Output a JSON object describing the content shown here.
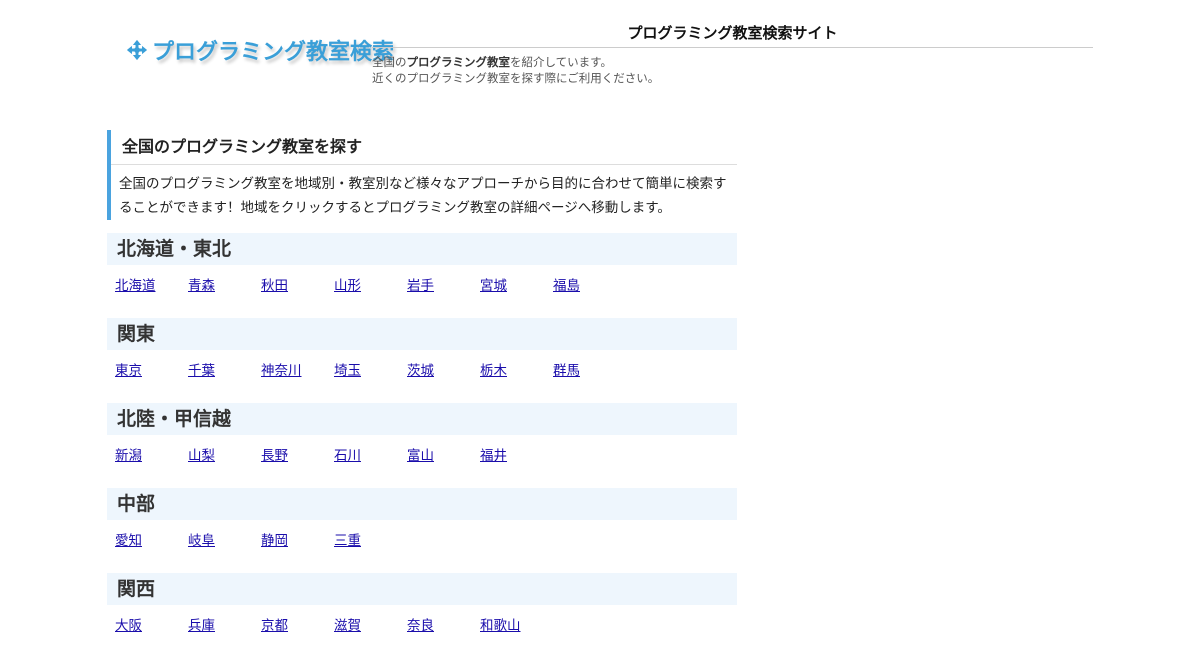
{
  "header": {
    "logo_text": "プログラミング教室検索",
    "logo_icon": "arrows-move-icon",
    "site_title": "プログラミング教室検索サイト",
    "desc_prefix": "全国の",
    "desc_bold": "プログラミング教室",
    "desc_suffix": "を紹介しています。",
    "desc_line2": "近くのプログラミング教室を探す際にご利用ください。"
  },
  "search": {
    "heading": "全国のプログラミング教室を探す",
    "text": "全国のプログラミング教室を地域別・教室別など様々なアプローチから目的に合わせて簡単に検索することができます！地域をクリックするとプログラミング教室の詳細ページへ移動します。"
  },
  "regions": [
    {
      "name": "北海道・東北",
      "prefs": [
        "北海道",
        "青森",
        "秋田",
        "山形",
        "岩手",
        "宮城",
        "福島"
      ]
    },
    {
      "name": "関東",
      "prefs": [
        "東京",
        "千葉",
        "神奈川",
        "埼玉",
        "茨城",
        "栃木",
        "群馬"
      ]
    },
    {
      "name": "北陸・甲信越",
      "prefs": [
        "新潟",
        "山梨",
        "長野",
        "石川",
        "富山",
        "福井"
      ]
    },
    {
      "name": "中部",
      "prefs": [
        "愛知",
        "岐阜",
        "静岡",
        "三重"
      ]
    },
    {
      "name": "関西",
      "prefs": [
        "大阪",
        "兵庫",
        "京都",
        "滋賀",
        "奈良",
        "和歌山"
      ]
    }
  ],
  "colors": {
    "accent": "#3a9fd8",
    "link": "#1a0dab",
    "region_bg": "#eef6fd",
    "section_border": "#4aa3df"
  }
}
